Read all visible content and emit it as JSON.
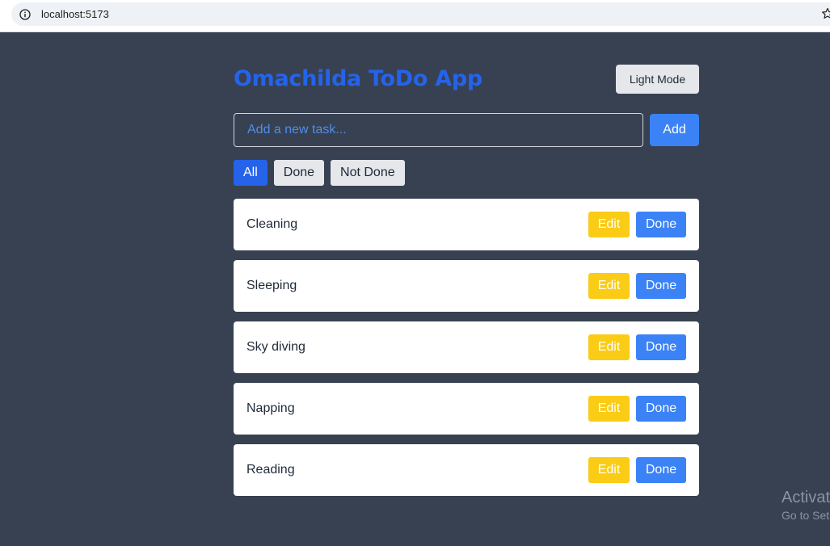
{
  "browser": {
    "url": "localhost:5173"
  },
  "app": {
    "title": "Omachilda ToDo App",
    "theme_toggle_label": "Light Mode",
    "input_placeholder": "Add a new task...",
    "input_value": "",
    "add_label": "Add",
    "filters": [
      {
        "label": "All",
        "active": true
      },
      {
        "label": "Done",
        "active": false
      },
      {
        "label": "Not Done",
        "active": false
      }
    ],
    "tasks": [
      {
        "label": "Cleaning",
        "edit_label": "Edit",
        "done_label": "Done"
      },
      {
        "label": "Sleeping",
        "edit_label": "Edit",
        "done_label": "Done"
      },
      {
        "label": "Sky diving",
        "edit_label": "Edit",
        "done_label": "Done"
      },
      {
        "label": "Napping",
        "edit_label": "Edit",
        "done_label": "Done"
      },
      {
        "label": "Reading",
        "edit_label": "Edit",
        "done_label": "Done"
      }
    ]
  },
  "watermark": {
    "line1": "Activat",
    "line2": "Go to Set"
  },
  "colors": {
    "background": "#374151",
    "title": "#2563eb",
    "primary": "#3b82f6",
    "active_filter": "#2563eb",
    "edit": "#facc15",
    "neutral_button": "#e5e7eb"
  },
  "icons": {
    "address_bar": "info-icon",
    "bookmark": "star-icon"
  }
}
